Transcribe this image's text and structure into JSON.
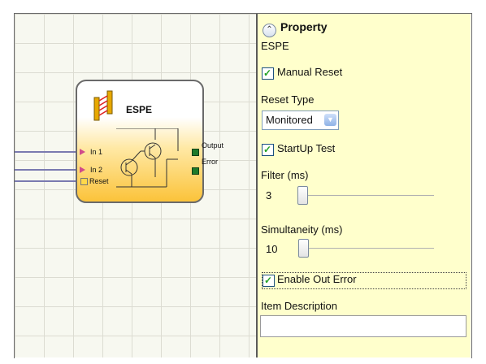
{
  "block": {
    "title": "ESPE",
    "inputs": [
      "In 1",
      "In 2",
      "Reset"
    ],
    "outputs": [
      "Output",
      "Error"
    ]
  },
  "panel": {
    "header": "Property",
    "component": "ESPE",
    "manual_reset": {
      "label": "Manual Reset",
      "checked": true
    },
    "reset_type": {
      "label": "Reset Type",
      "value": "Monitored"
    },
    "startup_test": {
      "label": "StartUp Test",
      "checked": true
    },
    "filter": {
      "label": "Filter (ms)",
      "value": "3"
    },
    "simultaneity": {
      "label": "Simultaneity (ms)",
      "value": "10"
    },
    "enable_out_error": {
      "label": "Enable Out Error",
      "checked": true
    },
    "item_description": {
      "label": "Item Description",
      "value": ""
    }
  },
  "icons": {
    "collapse": "chevron-up-icon",
    "checkbox": "checkmark-icon",
    "dropdown": "chevron-down-icon"
  },
  "colors": {
    "panel_bg": "#ffffcc",
    "block_gradient_end": "#fbc33a",
    "output_port": "#1e7a2a",
    "input_port": "#d04a8a"
  }
}
